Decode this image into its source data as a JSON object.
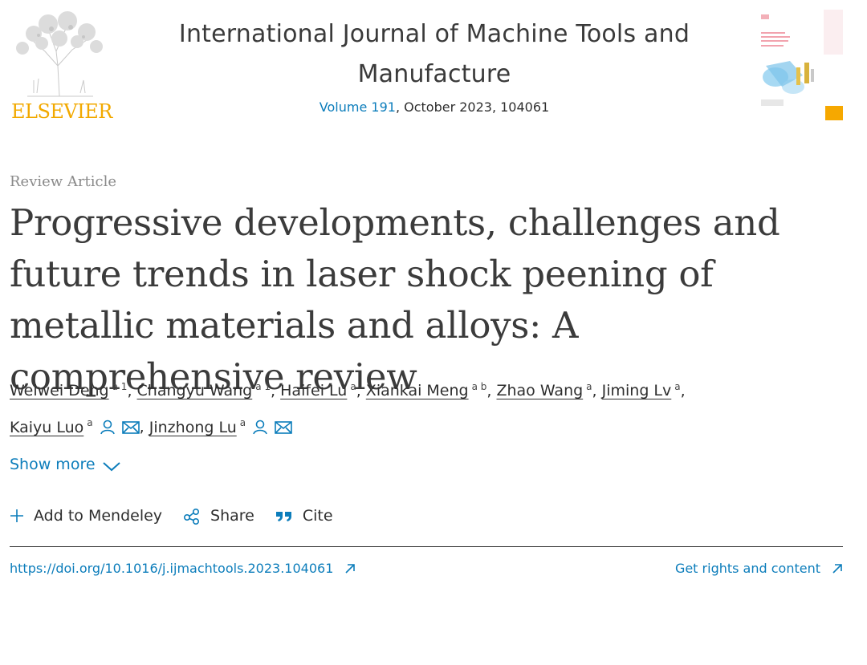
{
  "header": {
    "publisher_name": "ELSEVIER",
    "journal_title": "International Journal of Machine Tools and Manufacture",
    "volume_label": "Volume 191",
    "issue_details": ", October 2023, 104061"
  },
  "article": {
    "type": "Review Article",
    "title": "Progressive developments, challenges and future trends in laser shock peening of metallic materials and alloys: A comprehensive review"
  },
  "authors": [
    {
      "name": "Weiwei Deng",
      "aff": "a 1"
    },
    {
      "name": "Changyu Wang",
      "aff": "a 1"
    },
    {
      "name": "Haifei Lu",
      "aff": "a"
    },
    {
      "name": "Xiankai Meng",
      "aff": "a b"
    },
    {
      "name": "Zhao Wang",
      "aff": "a"
    },
    {
      "name": "Jiming Lv",
      "aff": "a"
    },
    {
      "name": "Kaiyu Luo",
      "aff": "a"
    },
    {
      "name": "Jinzhong Lu",
      "aff": "a"
    }
  ],
  "show_more_label": "Show more",
  "actions": {
    "add_mendeley": "Add to Mendeley",
    "share": "Share",
    "cite": "Cite"
  },
  "links": {
    "doi": "https://doi.org/10.1016/j.ijmachtools.2023.104061",
    "rights": "Get rights and content"
  },
  "colors": {
    "link_blue": "#0c7dbb",
    "elsevier_orange": "#f2a900",
    "text": "#2e2e2e"
  },
  "icons": [
    "elsevier-tree-logo",
    "journal-cover",
    "person-icon",
    "envelope-icon",
    "chevron-down-icon",
    "plus-icon",
    "share-icon",
    "quote-icon",
    "external-arrow-icon"
  ]
}
